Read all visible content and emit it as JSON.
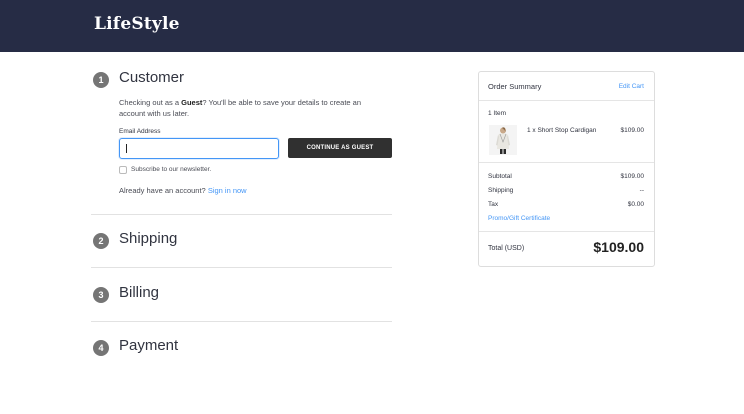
{
  "header": {
    "brand": "LifeStyle",
    "background": "#262c45"
  },
  "steps": [
    {
      "number": "1",
      "title": "Customer"
    },
    {
      "number": "2",
      "title": "Shipping"
    },
    {
      "number": "3",
      "title": "Billing"
    },
    {
      "number": "4",
      "title": "Payment"
    }
  ],
  "customer": {
    "intro_prefix": "Checking out as a ",
    "intro_bold": "Guest",
    "intro_suffix": "? You'll be able to save your details to create an account with us later.",
    "email_label": "Email Address",
    "email_value": "",
    "continue_label": "CONTINUE AS GUEST",
    "newsletter_label": "Subscribe to our newsletter.",
    "account_prompt": "Already have an account?",
    "signin_label": "Sign in now"
  },
  "summary": {
    "title": "Order Summary",
    "edit_cart": "Edit Cart",
    "item_count": "1 Item",
    "item": {
      "name": "1 x Short Stop Cardigan",
      "price": "$109.00"
    },
    "rows": [
      {
        "label": "Subtotal",
        "value": "$109.00"
      },
      {
        "label": "Shipping",
        "value": "--"
      },
      {
        "label": "Tax",
        "value": "$0.00"
      }
    ],
    "promo": "Promo/Gift Certificate",
    "total_label": "Total (USD)",
    "total_value": "$109.00"
  },
  "colors": {
    "accent_link": "#4496f6",
    "button": "#303030",
    "step_badge": "#757575"
  }
}
